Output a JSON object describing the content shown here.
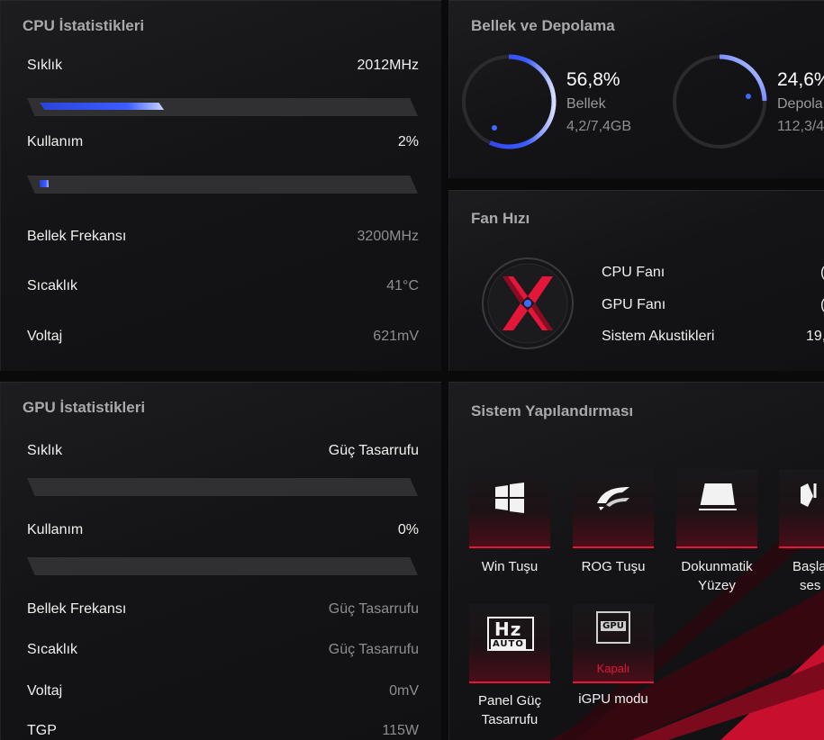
{
  "cpu": {
    "title": "CPU İstatistikleri",
    "rows": [
      {
        "label": "Sıklık",
        "value": "2012MHz"
      },
      {
        "label": "Kullanım",
        "value": "2%"
      },
      {
        "label": "Bellek Frekansı",
        "value": "3200MHz"
      },
      {
        "label": "Sıcaklık",
        "value": "41°C"
      },
      {
        "label": "Voltaj",
        "value": "621mV"
      }
    ],
    "frequency_bar_fraction": 0.34,
    "usage_bar_fraction": 0.02
  },
  "memory": {
    "title": "Bellek ve Depolama",
    "ram": {
      "percent": "56,8%",
      "name": "Bellek",
      "detail": "4,2/7,4GB",
      "fraction": 0.568
    },
    "storage": {
      "percent": "24,6%",
      "name": "Depola",
      "detail": "112,3/4",
      "fraction": 0.246
    }
  },
  "fan": {
    "title": "Fan Hızı",
    "rows": [
      {
        "label": "CPU Fanı",
        "value": "("
      },
      {
        "label": "GPU Fanı",
        "value": "("
      },
      {
        "label": "Sistem Akustikleri",
        "value": "19,"
      }
    ]
  },
  "gpu": {
    "title": "GPU İstatistikleri",
    "rows": [
      {
        "label": "Sıklık",
        "value": "Güç Tasarrufu"
      },
      {
        "label": "Kullanım",
        "value": "0%"
      },
      {
        "label": "Bellek Frekansı",
        "value": "Güç Tasarrufu"
      },
      {
        "label": "Sıcaklık",
        "value": "Güç Tasarrufu"
      },
      {
        "label": "Voltaj",
        "value": "0mV"
      },
      {
        "label": "TGP",
        "value": "115W"
      }
    ],
    "frequency_bar_fraction": 0,
    "usage_bar_fraction": 0
  },
  "system": {
    "title": "Sistem Yapılandırması",
    "tiles": [
      {
        "label_lines": [
          "Win Tuşu"
        ],
        "icon": "windows-icon"
      },
      {
        "label_lines": [
          "ROG Tuşu"
        ],
        "icon": "rog-icon"
      },
      {
        "label_lines": [
          "Dokunmatik",
          "Yüzey"
        ],
        "icon": "touchpad-icon"
      },
      {
        "label_lines": [
          "Başla",
          "ses"
        ],
        "icon": "boot-sound-icon"
      },
      {
        "label_lines": [
          "Panel Güç",
          "Tasarrufu"
        ],
        "icon": "hz-auto-icon",
        "icon_text_top": "Hz",
        "icon_text_bottom": "AUTO"
      },
      {
        "label_lines": [
          "iGPU modu"
        ],
        "icon": "gpu-icon",
        "icon_text_top": "GPU",
        "state": "Kapalı"
      }
    ]
  },
  "colors": {
    "accent_red": "#e4163a",
    "accent_blue": "#3b5cff"
  }
}
